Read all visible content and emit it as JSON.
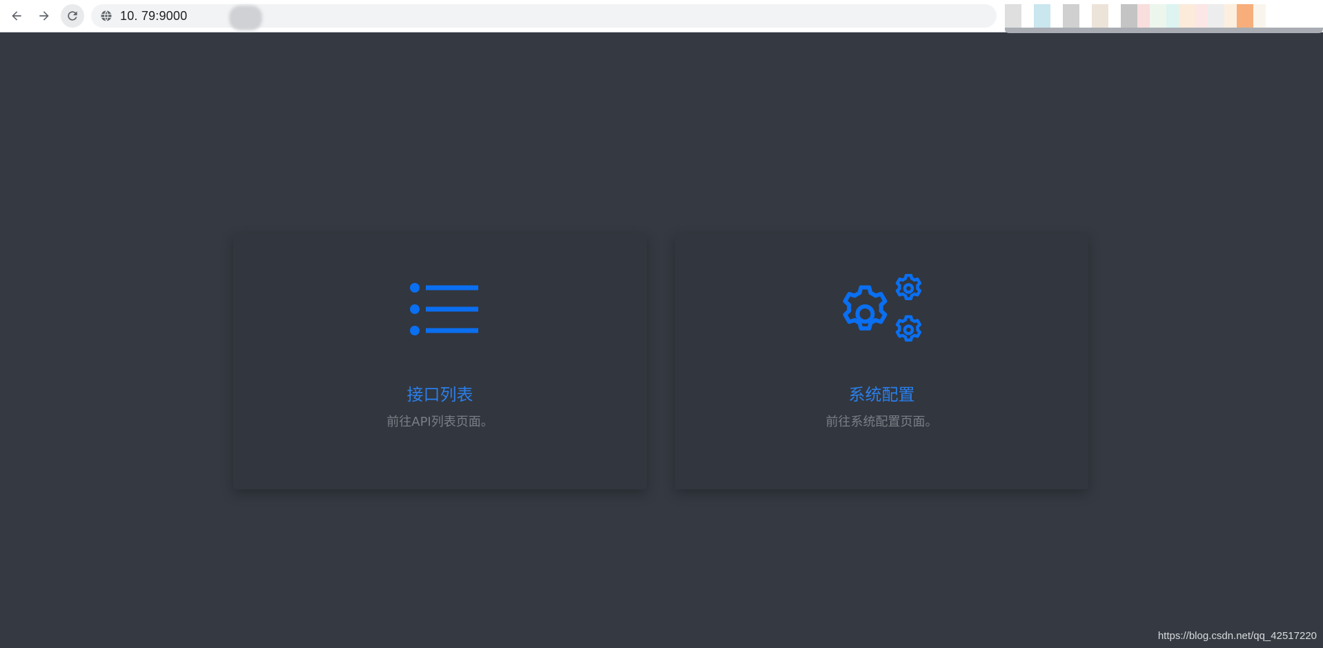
{
  "browser": {
    "url": "10.      79:9000",
    "extension_colors": [
      "#d7d7d7",
      "#ffffff",
      "#bde0ea",
      "#ffffff",
      "#c4c4c4",
      "#ffffff",
      "#e9ddd0",
      "#ffffff",
      "#b5b5b5",
      "#f8d6d6",
      "#e9f4e9",
      "#d5f1ee",
      "#fbe6d2",
      "#fbe0e0",
      "#e8e8e8",
      "#fcebd8",
      "#f59a5a",
      "#f8f2e8"
    ]
  },
  "cards": [
    {
      "title": "接口列表",
      "description": "前往API列表页面。",
      "icon": "list-icon"
    },
    {
      "title": "系统配置",
      "description": "前往系统配置页面。",
      "icon": "gears-icon"
    }
  ],
  "watermark": "https://blog.csdn.net/qq_42517220",
  "colors": {
    "background": "#353a42",
    "card": "#32363e",
    "accent": "#2a7fec",
    "muted_text": "#7a7e85"
  }
}
